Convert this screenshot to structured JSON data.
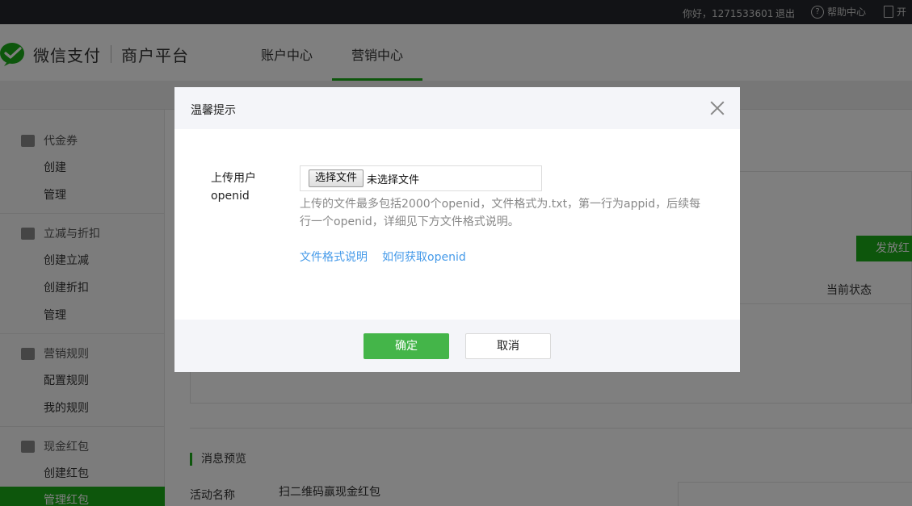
{
  "topbar": {
    "greeting": "你好，1271533601",
    "logout": "退出",
    "help": "帮助中心",
    "dev_doc": "开"
  },
  "header": {
    "brand": "微信支付",
    "platform": "商户平台",
    "tabs": [
      {
        "label": "账户中心",
        "active": false
      },
      {
        "label": "营销中心",
        "active": true
      }
    ]
  },
  "sidebar": {
    "groups": [
      {
        "label": "代金券",
        "items": [
          "创建",
          "管理"
        ]
      },
      {
        "label": "立减与折扣",
        "items": [
          "创建立减",
          "创建折扣",
          "管理"
        ]
      },
      {
        "label": "营销规则",
        "items": [
          "配置规则",
          "我的规则"
        ]
      },
      {
        "label": "现金红包",
        "items": [
          "创建红包",
          "管理红包"
        ]
      }
    ],
    "active_item": "管理红包"
  },
  "content": {
    "send_button": "发放红",
    "status_header": "当前状态",
    "section_title": "消息预览",
    "field_label": "活动名称",
    "field_value": "扫二维码赢现金红包"
  },
  "dialog": {
    "title": "温馨提示",
    "upload_label": "上传用户openid",
    "file_button": "选择文件",
    "file_status": "未选择文件",
    "tip": "上传的文件最多包括2000个openid，文件格式为.txt，第一行为appid，后续每行一个openid，详细见下方文件格式说明。",
    "link_format": "文件格式说明",
    "link_howto": "如何获取openid",
    "ok": "确定",
    "cancel": "取消"
  },
  "colors": {
    "accent_green": "#1aad19",
    "confirm_green": "#44b549",
    "link_blue": "#459ae9",
    "topbar_bg": "#24272c"
  }
}
